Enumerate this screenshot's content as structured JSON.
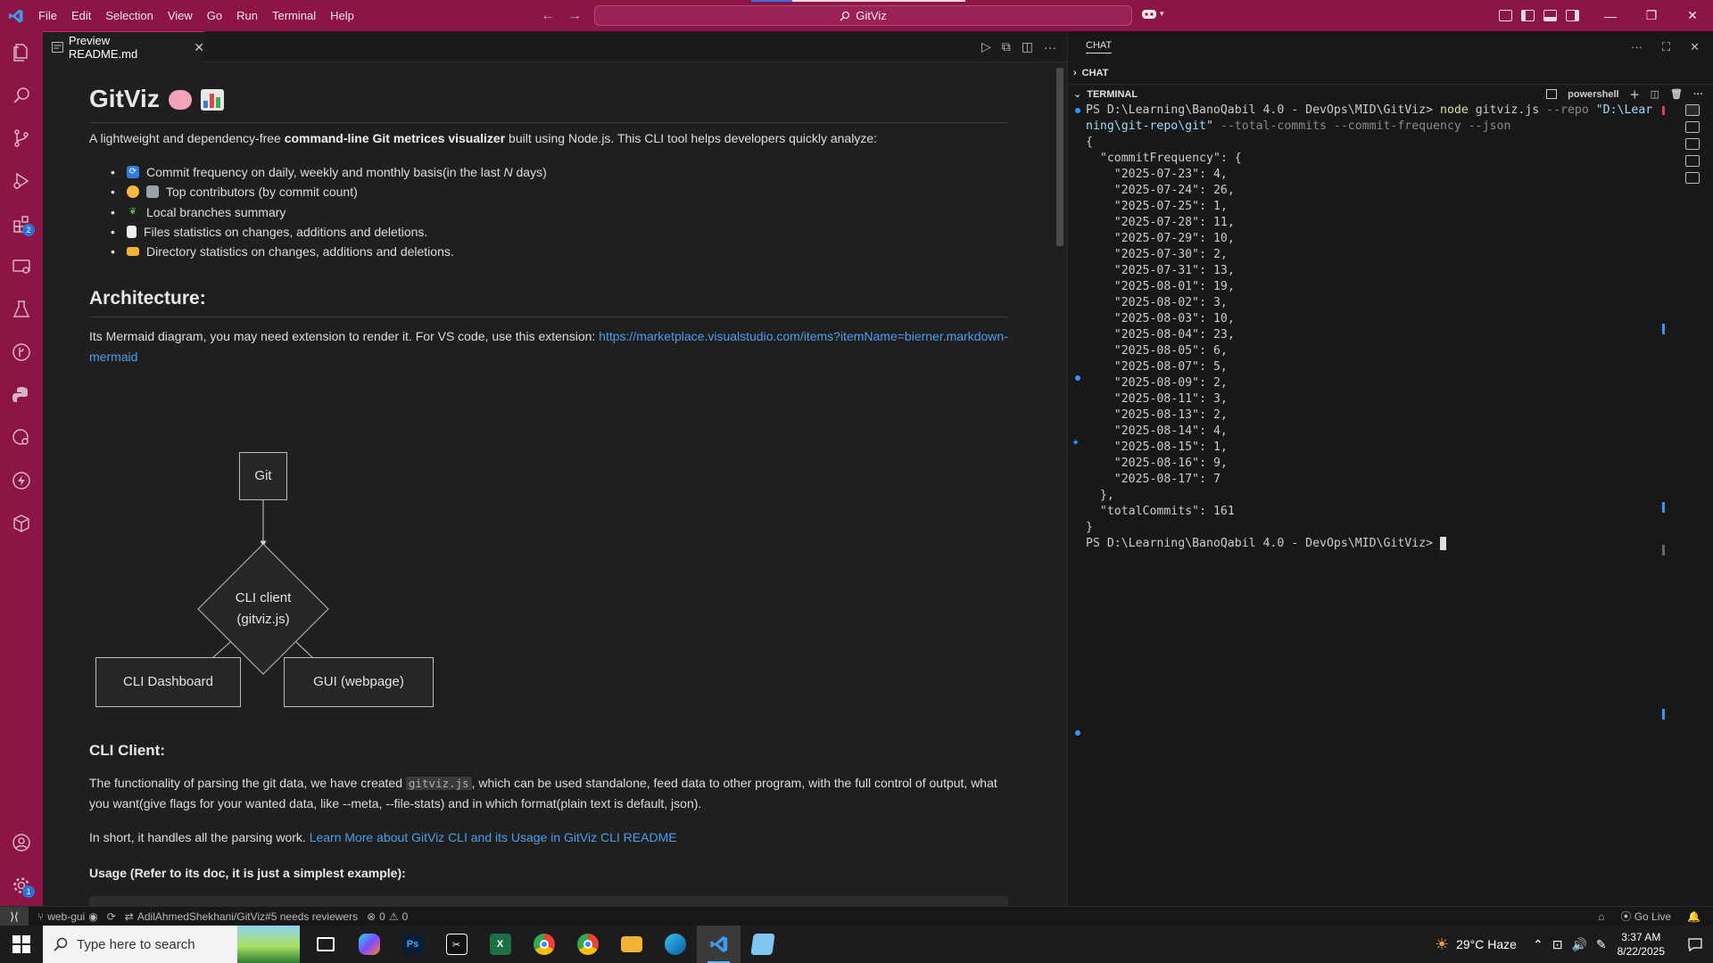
{
  "titlebar": {
    "menu": [
      "File",
      "Edit",
      "Selection",
      "View",
      "Go",
      "Run",
      "Terminal",
      "Help"
    ],
    "search": "GitViz"
  },
  "activity_badges": {
    "extensions": "2",
    "settings": "1"
  },
  "editor": {
    "tab_label": "Preview README.md",
    "title": "GitViz",
    "intro_pre": "A lightweight and dependency-free ",
    "intro_bold": "command-line Git metrices visualizer",
    "intro_post": " built using Node.js. This CLI tool helps developers quickly analyze:",
    "features": [
      {
        "pre": "Commit frequency on daily, weekly and monthly basis(in the last ",
        "em": "N",
        "post": " days)"
      },
      {
        "pre": "Top contributors (by commit count)",
        "em": "",
        "post": ""
      },
      {
        "pre": "Local branches summary",
        "em": "",
        "post": ""
      },
      {
        "pre": "Files statistics on changes, additions and deletions.",
        "em": "",
        "post": ""
      },
      {
        "pre": "Directory statistics on changes, additions and deletions.",
        "em": "",
        "post": ""
      }
    ],
    "arch_heading": "Architecture:",
    "arch_text": "Its Mermaid diagram, you may need extension to render it. For VS code, use this extension: ",
    "arch_link_1": "https://marketplace.visualstudio.com/items?itemName=bierner.markdown-",
    "arch_link_2": "mermaid",
    "diagram": {
      "git": "Git",
      "cli_client_1": "CLI client",
      "cli_client_2": "(gitviz.js)",
      "cli_dashboard": "CLI Dashboard",
      "gui": "GUI (webpage)"
    },
    "cli_heading": "CLI Client:",
    "cli_p1_pre": "The functionality of parsing the git data, we have created ",
    "cli_p1_code": "gitviz.js",
    "cli_p1_post": ", which can be used standalone, feed data to other program, with the full control of output, what",
    "cli_p1_line2": "you want(give flags for your wanted data, like --meta, --file-stats) and in which format(plain text is default, json).",
    "cli_p2_pre": "In short, it handles all the parsing work. ",
    "cli_p2_link": "Learn More about GitViz CLI and its Usage in GitViz CLI README",
    "usage_heading": "Usage (Refer to its doc, it is just a simplest example):"
  },
  "panel": {
    "chat_tab": "CHAT",
    "chat_section": "CHAT",
    "terminal_section": "TERMINAL",
    "shell": "powershell"
  },
  "terminal": {
    "prompt": "PS D:\\Learning\\BanoQabil 4.0 - DevOps\\MID\\GitViz>",
    "cmd": "node",
    "cmd_script": "gitviz.js",
    "cmd_flag_repo": "--repo",
    "cmd_repo_1": "\"D:\\Lear",
    "cmd_repo_2": "ning\\git-repo\\git\"",
    "cmd_rest": "--total-commits --commit-frequency --json",
    "key_commitFrequency": "\"commitFrequency\"",
    "commit_frequency": [
      {
        "date": "\"2025-07-23\"",
        "count": "4"
      },
      {
        "date": "\"2025-07-24\"",
        "count": "26"
      },
      {
        "date": "\"2025-07-25\"",
        "count": "1"
      },
      {
        "date": "\"2025-07-28\"",
        "count": "11"
      },
      {
        "date": "\"2025-07-29\"",
        "count": "10"
      },
      {
        "date": "\"2025-07-30\"",
        "count": "2"
      },
      {
        "date": "\"2025-07-31\"",
        "count": "13"
      },
      {
        "date": "\"2025-08-01\"",
        "count": "19"
      },
      {
        "date": "\"2025-08-02\"",
        "count": "3"
      },
      {
        "date": "\"2025-08-03\"",
        "count": "10"
      },
      {
        "date": "\"2025-08-04\"",
        "count": "23"
      },
      {
        "date": "\"2025-08-05\"",
        "count": "6"
      },
      {
        "date": "\"2025-08-07\"",
        "count": "5"
      },
      {
        "date": "\"2025-08-09\"",
        "count": "2"
      },
      {
        "date": "\"2025-08-11\"",
        "count": "3"
      },
      {
        "date": "\"2025-08-13\"",
        "count": "2"
      },
      {
        "date": "\"2025-08-14\"",
        "count": "4"
      },
      {
        "date": "\"2025-08-15\"",
        "count": "1"
      },
      {
        "date": "\"2025-08-16\"",
        "count": "9"
      },
      {
        "date": "\"2025-08-17\"",
        "count": "7"
      }
    ],
    "key_totalCommits": "\"totalCommits\"",
    "total_commits": "161"
  },
  "statusbar": {
    "branch": "web-gui",
    "pr": "AdilAhmedShekhani/GitViz#5 needs reviewers",
    "problems": "0",
    "warnings": "0",
    "golive": "Go Live"
  },
  "taskbar": {
    "search_placeholder": "Type here to search",
    "weather": "29°C  Haze",
    "time": "3:37 AM",
    "date": "8/22/2025"
  },
  "colors": {
    "accent": "#8c1447",
    "link": "#4d9dea",
    "terminal_dot": "#3794ff"
  }
}
